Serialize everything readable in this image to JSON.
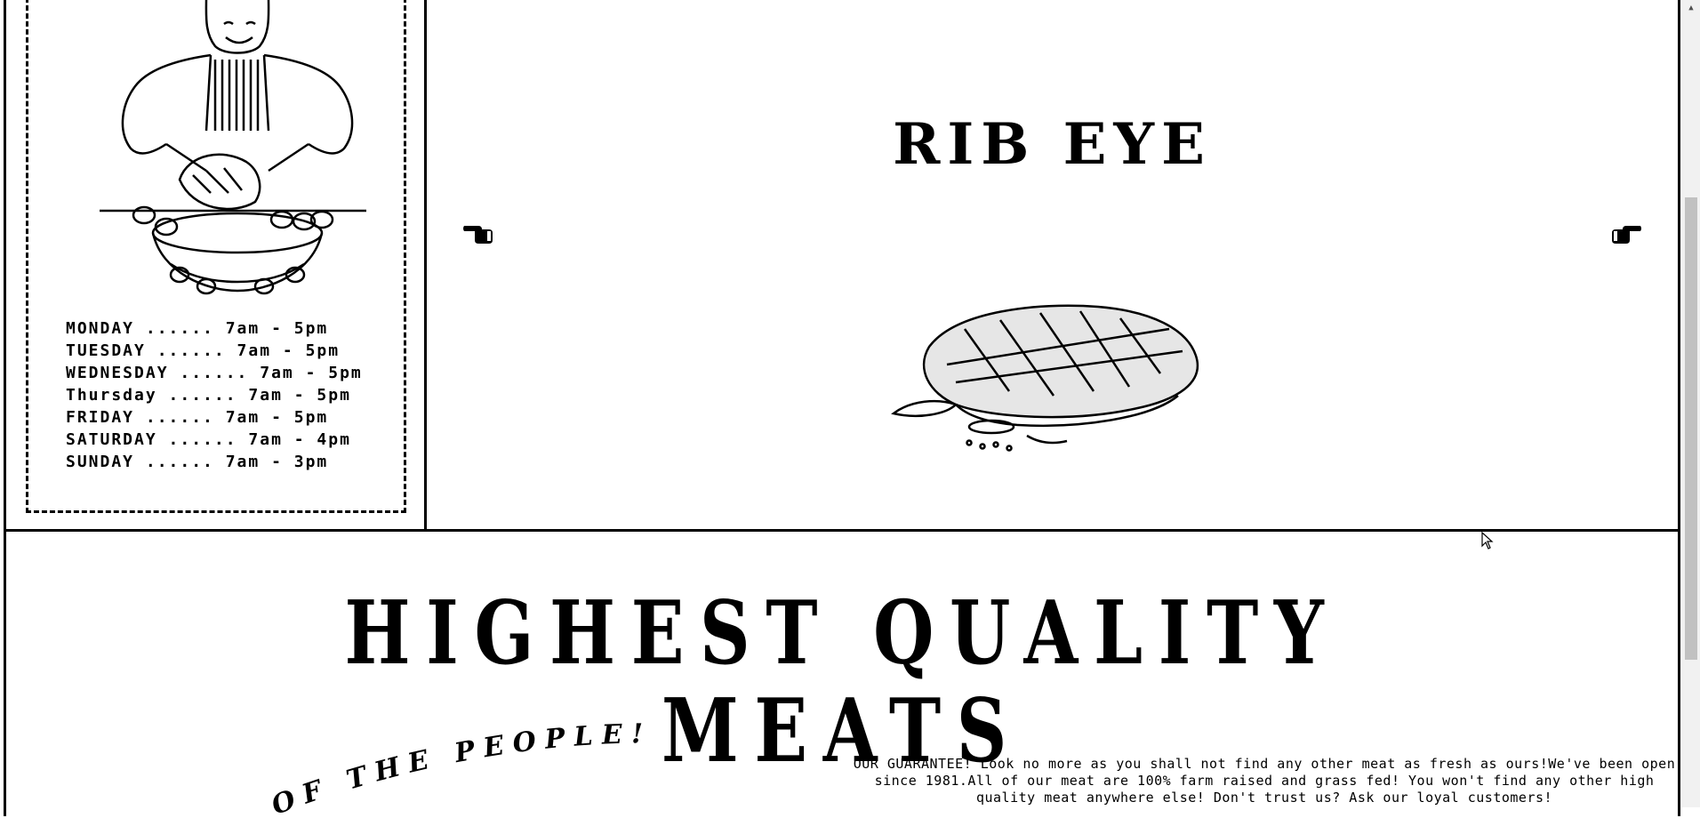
{
  "hours": [
    "MONDAY ...... 7am - 5pm",
    "TUESDAY ...... 7am - 5pm",
    "WEDNESDAY ...... 7am - 5pm",
    "Thursday ...... 7am - 5pm",
    "FRIDAY ...... 7am - 5pm",
    "SATURDAY ...... 7am - 4pm",
    "SUNDAY ...... 7am - 3pm"
  ],
  "slider": {
    "title": "RIB EYE",
    "prev_icon": "pointing-hand-left-icon",
    "next_icon": "pointing-hand-right-icon"
  },
  "headline": "HIGHEST QUALITY MEATS",
  "curved_text": "OF THE PEOPLE!",
  "guarantee": "OUR GUARANTEE! Look no more as you shall not find any other meat as fresh as ours!We've been open since 1981.All of our meat are 100% farm raised and grass fed! You won't find any other high quality meat anywhere else! Don't trust us? Ask our loyal customers!",
  "colors": {
    "ink": "#000000",
    "background": "#ffffff",
    "scrollbar_thumb": "#c1c1c1"
  }
}
